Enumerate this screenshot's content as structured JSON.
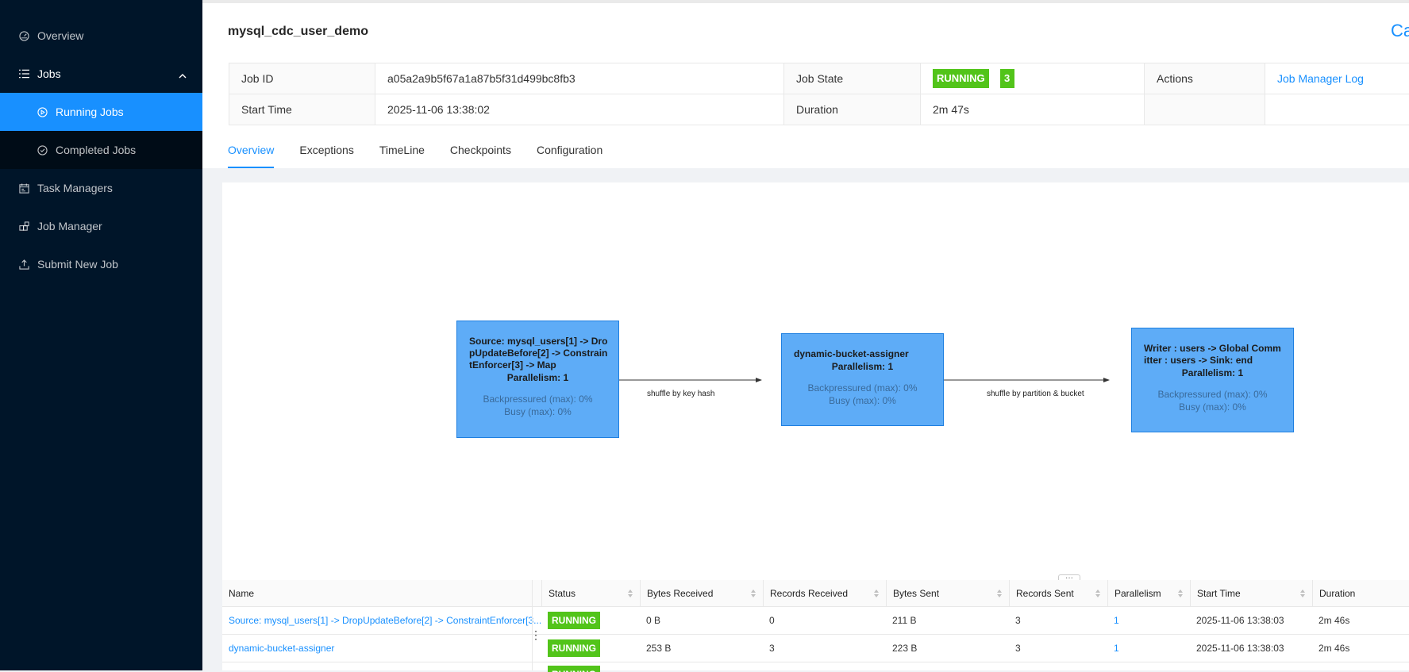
{
  "sidebar": {
    "items": [
      {
        "label": "Overview",
        "icon": "dashboard-icon"
      },
      {
        "label": "Jobs",
        "icon": "list-icon"
      },
      {
        "label": "Running Jobs",
        "icon": "play-circle-icon"
      },
      {
        "label": "Completed Jobs",
        "icon": "check-circle-icon"
      },
      {
        "label": "Task Managers",
        "icon": "schedule-icon"
      },
      {
        "label": "Job Manager",
        "icon": "build-icon"
      },
      {
        "label": "Submit New Job",
        "icon": "upload-icon"
      }
    ]
  },
  "header": {
    "job_name": "mysql_cdc_user_demo",
    "cancel_label": "Cancel Job"
  },
  "info": {
    "job_id_label": "Job ID",
    "job_id": "a05a2a9b5f67a1a87b5f31d499bc8fb3",
    "job_state_label": "Job State",
    "job_state": "RUNNING",
    "task_count": "3",
    "actions_label": "Actions",
    "job_manager_log": "Job Manager Log",
    "start_time_label": "Start Time",
    "start_time": "2025-11-06 13:38:02",
    "duration_label": "Duration",
    "duration": "2m 47s"
  },
  "tabs": [
    "Overview",
    "Exceptions",
    "TimeLine",
    "Checkpoints",
    "Configuration"
  ],
  "graph": {
    "nodes": [
      {
        "name": "Source: mysql_users[1] -> DropUpdateBefore[2] -> ConstraintEnforcer[3] -> Map",
        "parallelism": "Parallelism: 1",
        "backpressured": "Backpressured (max): 0%",
        "busy": "Busy (max): 0%"
      },
      {
        "name": "dynamic-bucket-assigner",
        "parallelism": "Parallelism: 1",
        "backpressured": "Backpressured (max): 0%",
        "busy": "Busy (max): 0%"
      },
      {
        "name": "Writer : users -> Global Committer : users -> Sink: end",
        "parallelism": "Parallelism: 1",
        "backpressured": "Backpressured (max): 0%",
        "busy": "Busy (max): 0%"
      }
    ],
    "edges": [
      "shuffle by key hash",
      "shuffle by partition & bucket"
    ]
  },
  "vertex_table": {
    "columns": [
      "Name",
      "Status",
      "Bytes Received",
      "Records Received",
      "Bytes Sent",
      "Records Sent",
      "Parallelism",
      "Start Time",
      "Duration"
    ],
    "rows": [
      [
        "Source: mysql_users[1] -> DropUpdateBefore[2] -> ConstraintEnforcer[3...",
        "RUNNING",
        "0 B",
        "0",
        "211 B",
        "3",
        "1",
        "2025-11-06 13:38:03",
        "2m 46s"
      ],
      [
        "dynamic-bucket-assigner",
        "RUNNING",
        "253 B",
        "3",
        "223 B",
        "3",
        "1",
        "2025-11-06 13:38:03",
        "2m 46s"
      ],
      [
        "",
        "RUNNING",
        "",
        "",
        "",
        "",
        "",
        "",
        ""
      ]
    ]
  }
}
